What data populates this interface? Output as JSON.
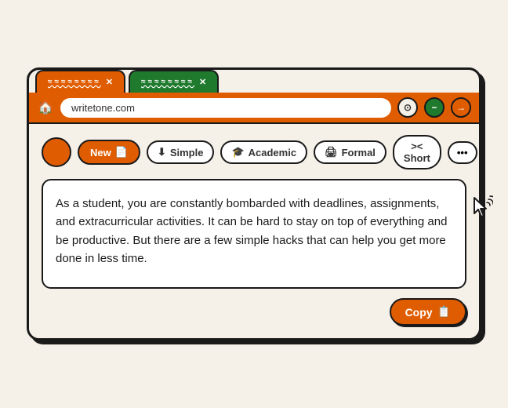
{
  "browser": {
    "tabs": [
      {
        "id": "tab1",
        "squiggle": "≈≈≈≈≈≈≈",
        "active": true,
        "color": "#e05c00"
      },
      {
        "id": "tab2",
        "squiggle": "≈≈≈≈≈≈≈",
        "active": false,
        "color": "#1f7a2e"
      }
    ],
    "address": "writetone.com",
    "nav_buttons": [
      {
        "label": "⊙",
        "style": "circle"
      },
      {
        "label": "−",
        "style": "green"
      },
      {
        "label": "→",
        "style": "orange"
      }
    ]
  },
  "toolbar": {
    "new_label": "New",
    "new_icon": "📄",
    "simple_label": "Simple",
    "simple_icon": "⬇",
    "academic_label": "Academic",
    "academic_icon": "🎓",
    "formal_label": "Formal",
    "formal_icon": "🖨",
    "short_label": ">< Short",
    "more_label": "•••"
  },
  "content": {
    "text": "As a student, you are constantly bombarded with deadlines, assignments, and extracurricular activities. It can be hard to stay on top of everything and be productive. But there are a few simple hacks that can help you get more done in less time."
  },
  "actions": {
    "copy_label": "Copy",
    "copy_icon": "📋"
  }
}
